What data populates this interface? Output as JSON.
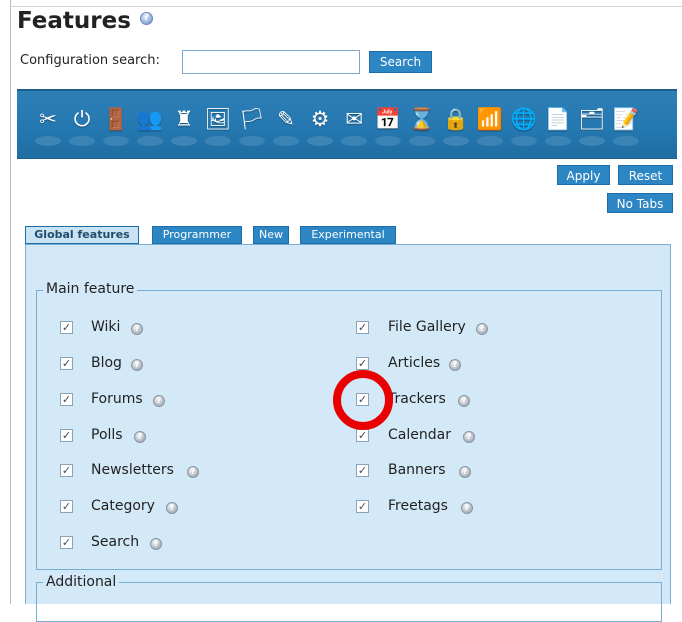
{
  "title": "Features",
  "help_mark": "?",
  "search": {
    "label": "Configuration search:",
    "placeholder": "",
    "value": "",
    "button_label": "Search"
  },
  "toolbar": {
    "icons": [
      "tools-icon",
      "power-icon",
      "login-icon",
      "users-icon",
      "chess-icon",
      "look-icon",
      "language-flag-icon",
      "text-area-icon",
      "modules-icon",
      "mail-icon",
      "calendar-icon",
      "hourglass-icon",
      "security-icon",
      "rss-icon",
      "web-icon",
      "wiki-icon",
      "stack-icon",
      "notepad-icon"
    ]
  },
  "actions": {
    "apply_label": "Apply",
    "reset_label": "Reset",
    "no_tabs_label": "No Tabs"
  },
  "tabs": [
    {
      "label": "Global features",
      "active": true
    },
    {
      "label": "Programmer",
      "active": false
    },
    {
      "label": "New",
      "active": false
    },
    {
      "label": "Experimental",
      "active": false
    }
  ],
  "main_feature": {
    "legend": "Main feature",
    "items": [
      {
        "label": "Wiki",
        "checked": true
      },
      {
        "label": "Blog",
        "checked": true
      },
      {
        "label": "Forums",
        "checked": true
      },
      {
        "label": "Polls",
        "checked": true
      },
      {
        "label": "Newsletters",
        "checked": true
      },
      {
        "label": "Category",
        "checked": true
      },
      {
        "label": "Search",
        "checked": true
      },
      {
        "label": "File Gallery",
        "checked": true
      },
      {
        "label": "Articles",
        "checked": true
      },
      {
        "label": "Trackers",
        "checked": true
      },
      {
        "label": "Calendar",
        "checked": true
      },
      {
        "label": "Banners",
        "checked": true
      },
      {
        "label": "Freetags",
        "checked": true
      }
    ]
  },
  "additional": {
    "legend": "Additional"
  },
  "colors": {
    "accent": "#2d86c4",
    "panel": "#d4e9f7",
    "highlight": "#ea0000"
  }
}
